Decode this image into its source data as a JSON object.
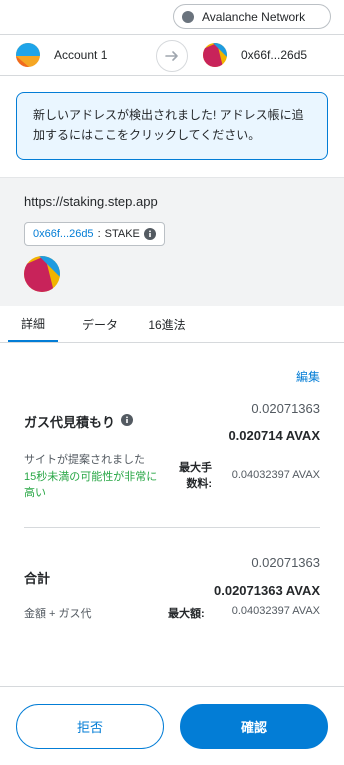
{
  "network": {
    "label": "Avalanche Network",
    "dot_color": "#6a737d"
  },
  "accounts": {
    "from_label": "Account 1",
    "to_label": "0x66f...26d5",
    "arrow_icon": "arrow-right-icon"
  },
  "notice": {
    "text": "新しいアドレスが検出されました! アドレス帳に追加するにはここをクリックしてください。"
  },
  "origin": {
    "url": "https://staking.step.app",
    "method_address": "0x66f...26d5",
    "method_separator": ":",
    "method_name": "STAKE"
  },
  "tabs": [
    {
      "label": "詳細"
    },
    {
      "label": "データ"
    },
    {
      "label": "16進法"
    }
  ],
  "edit_label": "編集",
  "gas": {
    "title": "ガス代見積もり",
    "fiat": "0.02071363",
    "native": "0.020714 AVAX",
    "suggested_by": "サイトが提案されました",
    "time_estimate": "15秒未満の可能性が非常に高い",
    "max_fee_label": "最大手数料:",
    "max_fee_value": "0.04032397 AVAX"
  },
  "total": {
    "title": "合計",
    "fiat": "0.02071363",
    "native": "0.02071363 AVAX",
    "subtitle": "金額 + ガス代",
    "max_amount_label": "最大額:",
    "max_amount_value": "0.04032397 AVAX"
  },
  "buttons": {
    "reject": "拒否",
    "confirm": "確認"
  },
  "colors": {
    "accent": "#037dd6",
    "success": "#28a745",
    "notice_bg": "#eaf6ff"
  }
}
